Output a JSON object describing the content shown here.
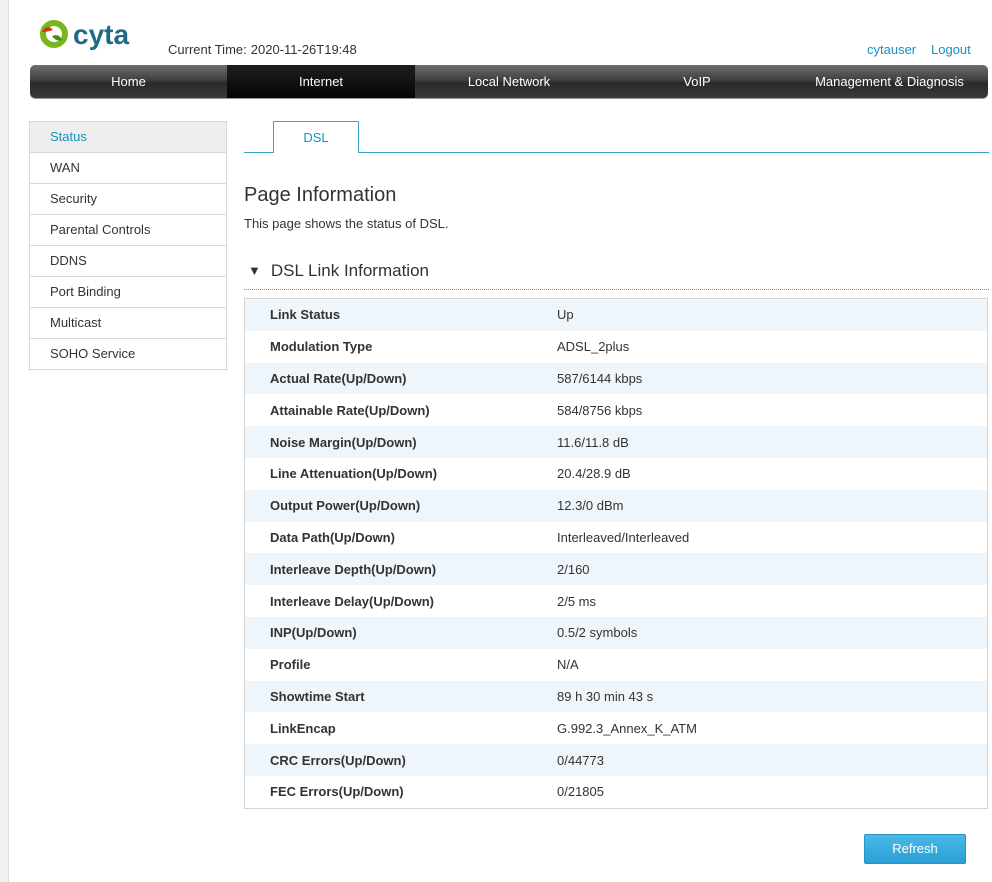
{
  "header": {
    "logo_text": "cyta",
    "current_time_label": "Current Time:",
    "current_time_value": "2020-11-26T19:48",
    "username": "cytauser",
    "logout_label": "Logout"
  },
  "nav": {
    "items": [
      {
        "label": "Home",
        "active": false
      },
      {
        "label": "Internet",
        "active": true
      },
      {
        "label": "Local Network",
        "active": false
      },
      {
        "label": "VoIP",
        "active": false
      },
      {
        "label": "Management & Diagnosis",
        "active": false
      }
    ]
  },
  "sidebar": {
    "items": [
      {
        "label": "Status",
        "active": true
      },
      {
        "label": "WAN",
        "active": false
      },
      {
        "label": "Security",
        "active": false
      },
      {
        "label": "Parental Controls",
        "active": false
      },
      {
        "label": "DDNS",
        "active": false
      },
      {
        "label": "Port Binding",
        "active": false
      },
      {
        "label": "Multicast",
        "active": false
      },
      {
        "label": "SOHO Service",
        "active": false
      }
    ]
  },
  "tabs": [
    {
      "label": "DSL",
      "active": true
    }
  ],
  "page": {
    "title": "Page Information",
    "description": "This page shows the status of DSL."
  },
  "section": {
    "title": "DSL Link Information",
    "collapse_glyph": "▼"
  },
  "dsl_info": [
    {
      "key": "Link Status",
      "value": "Up"
    },
    {
      "key": "Modulation Type",
      "value": "ADSL_2plus"
    },
    {
      "key": "Actual Rate(Up/Down)",
      "value": "587/6144 kbps"
    },
    {
      "key": "Attainable Rate(Up/Down)",
      "value": "584/8756 kbps"
    },
    {
      "key": "Noise Margin(Up/Down)",
      "value": "11.6/11.8 dB"
    },
    {
      "key": "Line Attenuation(Up/Down)",
      "value": "20.4/28.9 dB"
    },
    {
      "key": "Output Power(Up/Down)",
      "value": "12.3/0 dBm"
    },
    {
      "key": "Data Path(Up/Down)",
      "value": "Interleaved/Interleaved"
    },
    {
      "key": "Interleave Depth(Up/Down)",
      "value": "2/160"
    },
    {
      "key": "Interleave Delay(Up/Down)",
      "value": "2/5 ms"
    },
    {
      "key": "INP(Up/Down)",
      "value": "0.5/2 symbols"
    },
    {
      "key": "Profile",
      "value": "N/A"
    },
    {
      "key": "Showtime Start",
      "value": "89 h 30 min 43 s"
    },
    {
      "key": "LinkEncap",
      "value": "G.992.3_Annex_K_ATM"
    },
    {
      "key": "CRC Errors(Up/Down)",
      "value": "0/44773"
    },
    {
      "key": "FEC Errors(Up/Down)",
      "value": "0/21805"
    }
  ],
  "actions": {
    "refresh_label": "Refresh"
  },
  "colors": {
    "accent": "#1a8fc4",
    "button": "#2a9fd4",
    "nav_bg": "#3a3a3a",
    "nav_active": "#0a0a0a",
    "row_alt": "#eef5fb",
    "logo_green": "#7ab51d",
    "logo_red": "#e0301e"
  }
}
